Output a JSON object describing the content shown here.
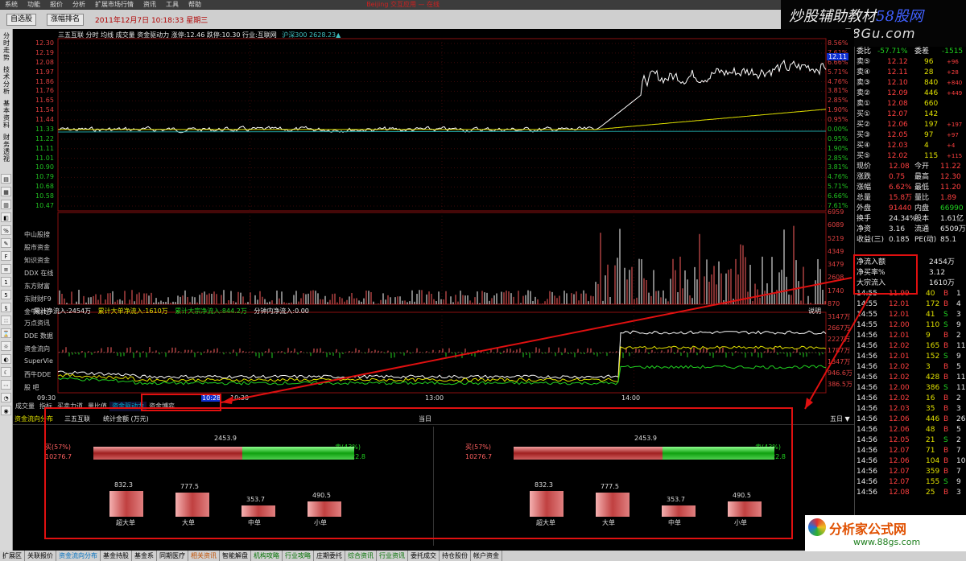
{
  "menu": [
    "系统",
    "功能",
    "报价",
    "分析",
    "扩展市场行情",
    "资讯",
    "工具",
    "帮助"
  ],
  "window_title": "Beijing 交互应用 — 在线",
  "toolbar": {
    "tab1": "自选股",
    "tab2": "涨幅排名",
    "datetime": "2011年12月7日  10:18:33 星期三"
  },
  "logo": {
    "line1": "炒股辅助教材",
    "line1b": "58股网",
    "line2": "www.58Gu.com"
  },
  "leftbar": [
    "分时走势",
    "技术分析",
    "基本资料",
    "财务透视"
  ],
  "chart": {
    "header": "三五互联   分时  均线  成交量  资金驱动力  涨停:12.46  跌停:10.30  行业:互联网",
    "index": "沪深300 2628.23▲",
    "price_levels": [
      "12.30",
      "12.19",
      "12.08",
      "11.97",
      "11.86",
      "11.76",
      "11.65",
      "11.54",
      "11.44",
      "11.33",
      "11.22",
      "11.11",
      "11.01",
      "10.90",
      "10.79",
      "10.68",
      "10.58",
      "10.47"
    ],
    "pct_levels": [
      "8.56%",
      "7.61%",
      "6.66%",
      "5.71%",
      "4.76%",
      "3.81%",
      "2.85%",
      "1.90%",
      "0.95%",
      "0.00%",
      "0.95%",
      "1.90%",
      "2.85%",
      "3.81%",
      "4.76%",
      "5.71%",
      "6.66%",
      "7.61%"
    ],
    "current_box": "12.11",
    "vol_levels": [
      "6959",
      "6089",
      "5219",
      "4349",
      "3479",
      "2608",
      "1740",
      "870"
    ],
    "vol_labels": [
      "中山股搜",
      "股市资金",
      "知识资金",
      "DDX 在线",
      "东方财富",
      "东财财F9",
      "金牛财经"
    ],
    "flow_header": "累计净流入:2454万",
    "flow_big": "累计大单净流入:1610万",
    "flow_block": "累计大宗净流入:844.2万",
    "flow_minute": "分钟内净流入:0.00",
    "flow_levels": [
      "3147万",
      "2667万",
      "2227万",
      "1787万",
      "1347万",
      "946.6万",
      "386.5万"
    ],
    "flow_labels": [
      "万点资讯",
      "DDE 数据",
      "资金流向",
      "SuperVie",
      "西牛DDE",
      "股 吧"
    ],
    "help_label": "说明",
    "time_labels": [
      "09:30",
      "10:28",
      "10:30",
      "13:00",
      "14:00"
    ]
  },
  "bottom_tabs": [
    "成交量",
    "指标",
    "买卖力道",
    "量比值",
    "资金驱动力",
    "资金博弈"
  ],
  "lower": {
    "tabs": [
      "资金流向分布",
      "三五互联",
      "统计金额 (万元)"
    ],
    "today": "当日",
    "five": "五日 ▼",
    "net": "2453.9",
    "buy_pct": "买(57%)",
    "buy_amt": "10276.7",
    "sell_pct": "卖(43%)",
    "sell_amt": "7822.8",
    "buy_fraction": 0.57,
    "bars": [
      {
        "label": "超大单",
        "value": "832.3",
        "num": 832.3
      },
      {
        "label": "大单",
        "value": "777.5",
        "num": 777.5
      },
      {
        "label": "中单",
        "value": "353.7",
        "num": 353.7
      },
      {
        "label": "小单",
        "value": "490.5",
        "num": 490.5
      }
    ]
  },
  "right": {
    "weibi": {
      "label": "委比",
      "value": "-57.71%",
      "label2": "委差",
      "value2": "-1515"
    },
    "sell": [
      {
        "l": "卖⑤",
        "p": "12.12",
        "v": "96",
        "c": "+96"
      },
      {
        "l": "卖④",
        "p": "12.11",
        "v": "28",
        "c": "+28"
      },
      {
        "l": "卖③",
        "p": "12.10",
        "v": "840",
        "c": "+840"
      },
      {
        "l": "卖②",
        "p": "12.09",
        "v": "446",
        "c": "+449"
      },
      {
        "l": "卖①",
        "p": "12.08",
        "v": "660",
        "c": ""
      }
    ],
    "buy": [
      {
        "l": "买①",
        "p": "12.07",
        "v": "142",
        "c": ""
      },
      {
        "l": "买②",
        "p": "12.06",
        "v": "197",
        "c": "+197"
      },
      {
        "l": "买③",
        "p": "12.05",
        "v": "97",
        "c": "+97"
      },
      {
        "l": "买④",
        "p": "12.03",
        "v": "4",
        "c": "+4"
      },
      {
        "l": "买⑤",
        "p": "12.02",
        "v": "115",
        "c": "+115"
      }
    ],
    "quote": [
      [
        "现价",
        "12.08",
        "今开",
        "11.22"
      ],
      [
        "涨跌",
        "0.75",
        "最高",
        "12.30"
      ],
      [
        "涨幅",
        "6.62%",
        "最低",
        "11.20"
      ],
      [
        "总量",
        "15.8万",
        "量比",
        "1.89"
      ],
      [
        "外盘",
        "91440",
        "内盘",
        "66990"
      ],
      [
        "换手",
        "24.34%",
        "股本",
        "1.61亿"
      ],
      [
        "净资",
        "3.16",
        "流通",
        "6509万"
      ],
      [
        "收益(三)",
        "0.185",
        "PE(动)",
        "85.1"
      ]
    ],
    "flow": [
      [
        "净流入额",
        "2454万"
      ],
      [
        "净买率%",
        "3.12"
      ],
      [
        "大宗流入",
        "1610万"
      ]
    ],
    "ticks": [
      [
        "14:55",
        "11.99",
        "40",
        "B",
        "1"
      ],
      [
        "14:55",
        "12.01",
        "172",
        "B",
        "4"
      ],
      [
        "14:55",
        "12.01",
        "41",
        "S",
        "3"
      ],
      [
        "14:55",
        "12.00",
        "110",
        "S",
        "9"
      ],
      [
        "14:56",
        "12.01",
        "9",
        "B",
        "2"
      ],
      [
        "14:56",
        "12.02",
        "165",
        "B",
        "11"
      ],
      [
        "14:56",
        "12.01",
        "152",
        "S",
        "9"
      ],
      [
        "14:56",
        "12.02",
        "3",
        "B",
        "5"
      ],
      [
        "14:56",
        "12.02",
        "428",
        "B",
        "11"
      ],
      [
        "14:56",
        "12.00",
        "386",
        "S",
        "11"
      ],
      [
        "14:56",
        "12.02",
        "16",
        "B",
        "2"
      ],
      [
        "14:56",
        "12.03",
        "35",
        "B",
        "3"
      ],
      [
        "14:56",
        "12.06",
        "446",
        "B",
        "26"
      ],
      [
        "14:56",
        "12.06",
        "48",
        "B",
        "5"
      ],
      [
        "14:56",
        "12.05",
        "21",
        "S",
        "2"
      ],
      [
        "14:56",
        "12.07",
        "71",
        "B",
        "7"
      ],
      [
        "14:56",
        "12.06",
        "104",
        "B",
        "10"
      ],
      [
        "14:56",
        "12.07",
        "359",
        "B",
        "7"
      ],
      [
        "14:56",
        "12.07",
        "155",
        "S",
        "9"
      ],
      [
        "14:56",
        "12.08",
        "25",
        "B",
        "3"
      ]
    ]
  },
  "statusbar": [
    "扩展区",
    "关联报价",
    "资金流向分布",
    "基金持股",
    "基金系",
    "同期医疗",
    "相关资讯",
    "智能解盘",
    "机构攻略",
    "行业攻略",
    "庄期委托",
    "综合资讯",
    "行业资讯",
    "委托成交",
    "持仓股份",
    "帐户资金"
  ],
  "ad": {
    "title": "分析家公式网",
    "url": "www.88gs.com"
  },
  "colors": {
    "up": "#ff4040",
    "down": "#20d020",
    "price_line": "#ffffff",
    "avg_line": "#e0e000",
    "box": "#e01010"
  }
}
